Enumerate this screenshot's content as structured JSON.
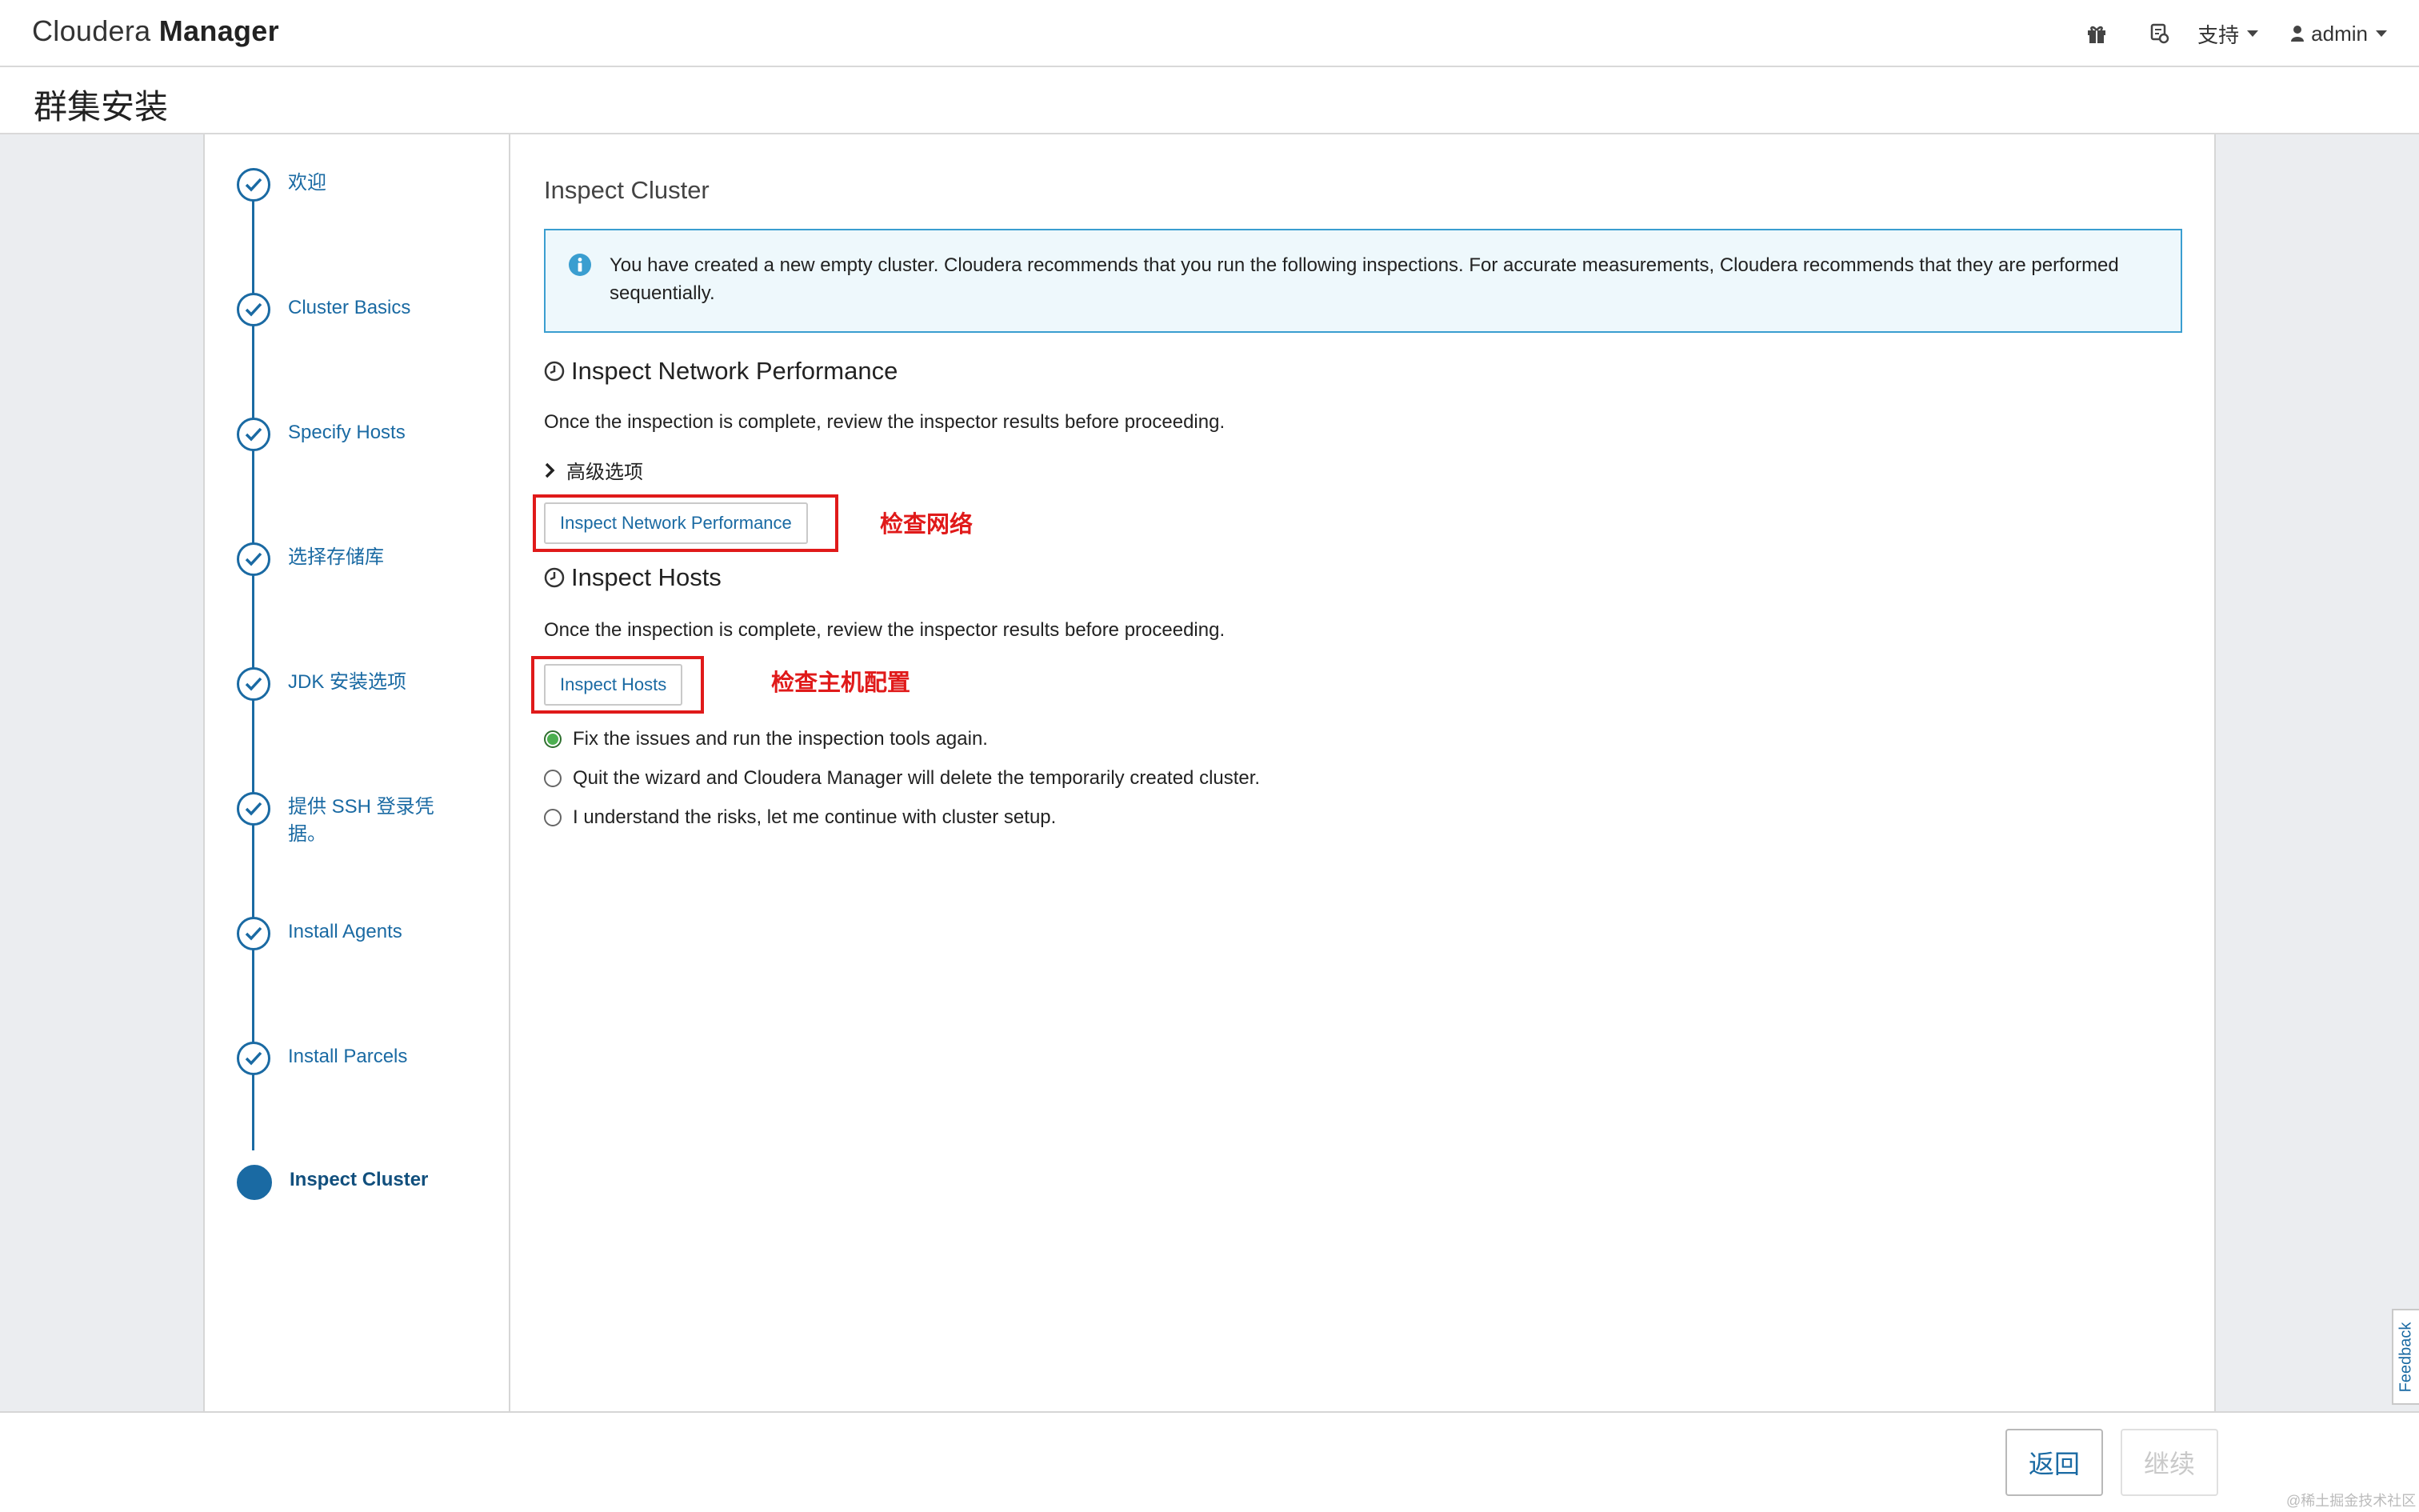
{
  "app": {
    "brand_light": "Cloudera ",
    "brand_bold": "Manager"
  },
  "topnav": {
    "support_label": "支持",
    "user_label": "admin",
    "icons": [
      "gift-icon",
      "cluster-alert-icon",
      "user-icon"
    ]
  },
  "page": {
    "title": "群集安装"
  },
  "steps": [
    {
      "label": "欢迎",
      "state": "done"
    },
    {
      "label": "Cluster Basics",
      "state": "done"
    },
    {
      "label": "Specify Hosts",
      "state": "done"
    },
    {
      "label": "选择存储库",
      "state": "done"
    },
    {
      "label": "JDK 安装选项",
      "state": "done"
    },
    {
      "label": "提供 SSH 登录凭据。",
      "state": "done"
    },
    {
      "label": "Install Agents",
      "state": "done"
    },
    {
      "label": "Install Parcels",
      "state": "done"
    },
    {
      "label": "Inspect Cluster",
      "state": "active"
    }
  ],
  "main": {
    "heading": "Inspect Cluster",
    "alert": "You have created a new empty cluster. Cloudera recommends that you run the following inspections. For accurate measurements, Cloudera recommends that they are performed sequentially.",
    "network": {
      "title": "Inspect Network Performance",
      "desc": "Once the inspection is complete, review the inspector results before proceeding.",
      "advanced": "高级选项",
      "button": "Inspect Network Performance",
      "annotation": "检查网络"
    },
    "hosts": {
      "title": "Inspect Hosts",
      "desc": "Once the inspection is complete, review the inspector results before proceeding.",
      "button": "Inspect Hosts",
      "annotation": "检查主机配置"
    },
    "options": [
      {
        "label": "Fix the issues and run the inspection tools again.",
        "checked": true
      },
      {
        "label": "Quit the wizard and Cloudera Manager will delete the temporarily created cluster.",
        "checked": false
      },
      {
        "label": "I understand the risks, let me continue with cluster setup.",
        "checked": false
      }
    ]
  },
  "footer": {
    "back": "返回",
    "next": "继续"
  },
  "feedback": "Feedback",
  "watermark": "@稀土掘金技术社区",
  "colors": {
    "primary": "#1a6aa3",
    "annotation": "#e01a1a",
    "alert_bg": "#eef8fc",
    "alert_border": "#3a9ed0"
  }
}
